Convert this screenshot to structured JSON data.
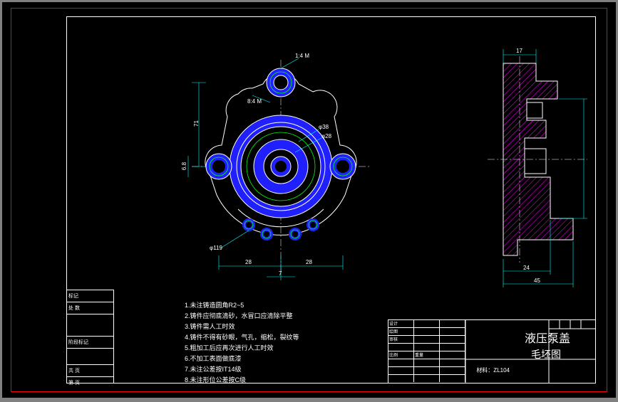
{
  "title": {
    "part_name": "液压泵盖",
    "drawing_type": "毛坯图",
    "material": "材料：ZL104"
  },
  "notes": {
    "n1": "1.未注铸造圆角R2~5",
    "n2": "2.铸件应彻底清砂，水冒口应清除平整",
    "n3": "3.铸件需人工时效",
    "n4": "4.铸件不得有砂眼，气孔，缩松，裂纹等",
    "n5": "5.粗加工后应再次进行人工时效",
    "n6": "6.不加工表面做底漆",
    "n7": "7.未注公差按IT14级",
    "n8": "8.未注形位公差按C级"
  },
  "dimensions": {
    "top_leader": "1:4 M",
    "mid_leader": "8:4 M",
    "phi1": "φ38",
    "phi2": "φ28",
    "bolt_circle": "φ119",
    "height_main": "71",
    "height_sec": "6.8",
    "width_left": "28",
    "width_right": "28",
    "width_center": "7",
    "side_top": "17",
    "side_width": "24",
    "side_full": "45"
  },
  "rev_labels": {
    "r1": "标记",
    "r2": "处 数",
    "r3": "阶段标记",
    "r4": "共   页",
    "r5": "第   页"
  },
  "tb_labels": {
    "design": "设计",
    "draw": "绘图",
    "check": "审核",
    "scale": "比例",
    "weight": "重量"
  }
}
